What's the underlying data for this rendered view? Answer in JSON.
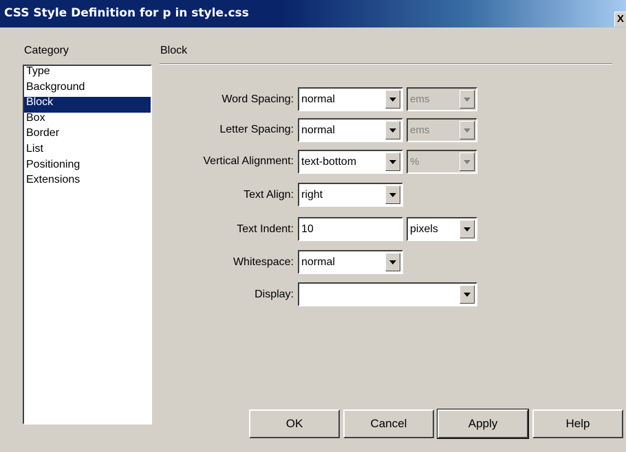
{
  "window": {
    "title": "CSS Style Definition for p in style.css",
    "close_glyph": "X"
  },
  "category": {
    "heading": "Category",
    "items": [
      "Type",
      "Background",
      "Block",
      "Box",
      "Border",
      "List",
      "Positioning",
      "Extensions"
    ],
    "selected": "Block"
  },
  "panel": {
    "heading": "Block"
  },
  "fields": {
    "word_spacing": {
      "label": "Word Spacing:",
      "value": "normal",
      "unit": "ems"
    },
    "letter_spacing": {
      "label": "Letter Spacing:",
      "value": "normal",
      "unit": "ems"
    },
    "vertical_alignment": {
      "label": "Vertical Alignment:",
      "value": "text-bottom",
      "unit": "%"
    },
    "text_align": {
      "label": "Text Align:",
      "value": "right"
    },
    "text_indent": {
      "label": "Text Indent:",
      "value": "10",
      "unit": "pixels"
    },
    "whitespace": {
      "label": "Whitespace:",
      "value": "normal"
    },
    "display": {
      "label": "Display:",
      "value": ""
    }
  },
  "buttons": {
    "ok": "OK",
    "cancel": "Cancel",
    "apply": "Apply",
    "help": "Help"
  },
  "colors": {
    "title_bar": "#0a246a",
    "face": "#d4d0c8",
    "selection": "#0a246a"
  }
}
